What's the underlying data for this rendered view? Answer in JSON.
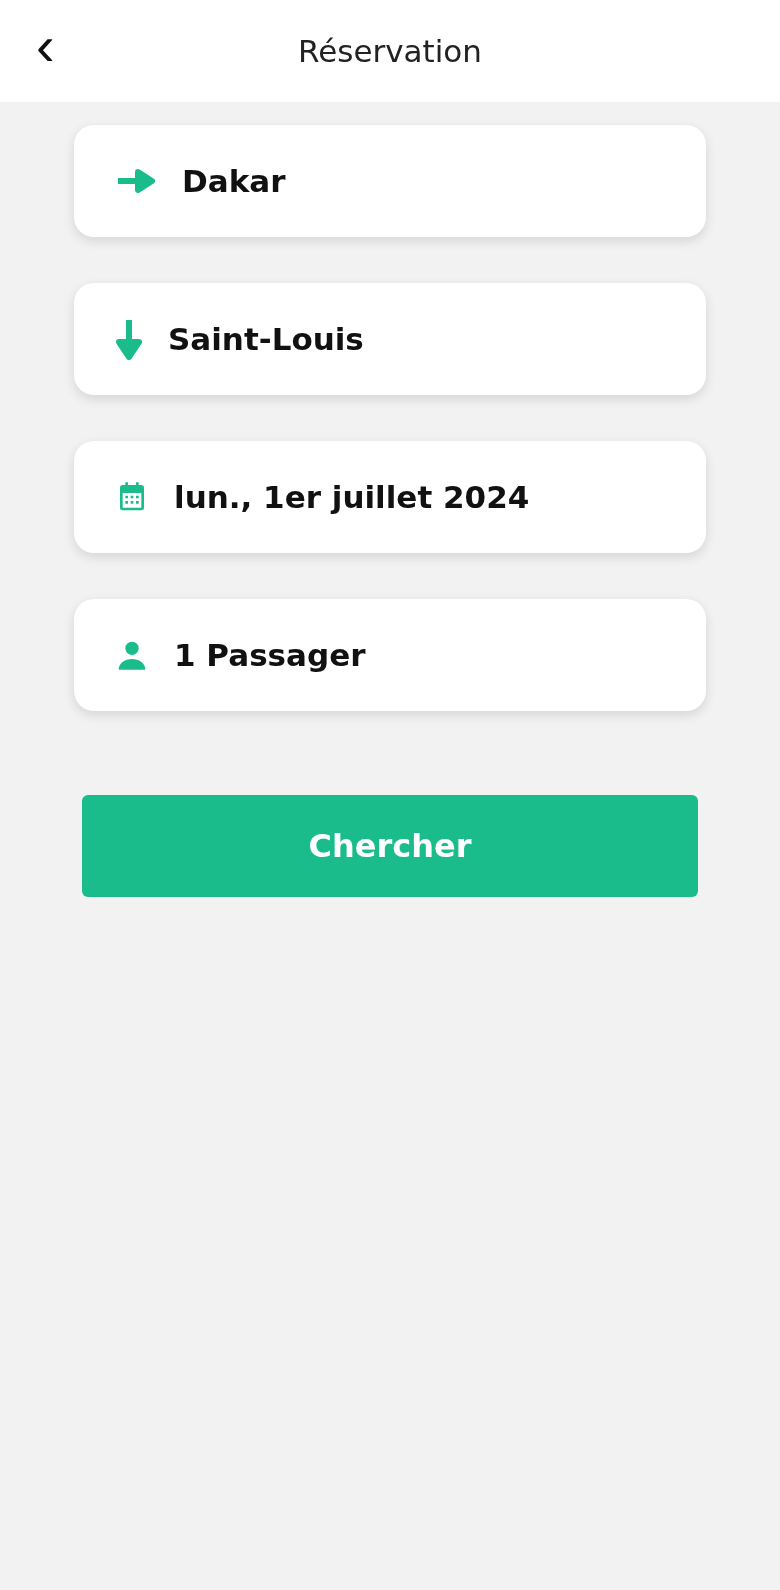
{
  "header": {
    "back": "‹",
    "title": "Réservation"
  },
  "fields": [
    {
      "kind": "origin",
      "value": "Dakar"
    },
    {
      "kind": "destination",
      "value": "Saint-Louis"
    },
    {
      "kind": "date",
      "value": "lun., 1er juillet 2024"
    },
    {
      "kind": "passengers",
      "value": "1 Passager"
    }
  ],
  "search_button": "Chercher"
}
